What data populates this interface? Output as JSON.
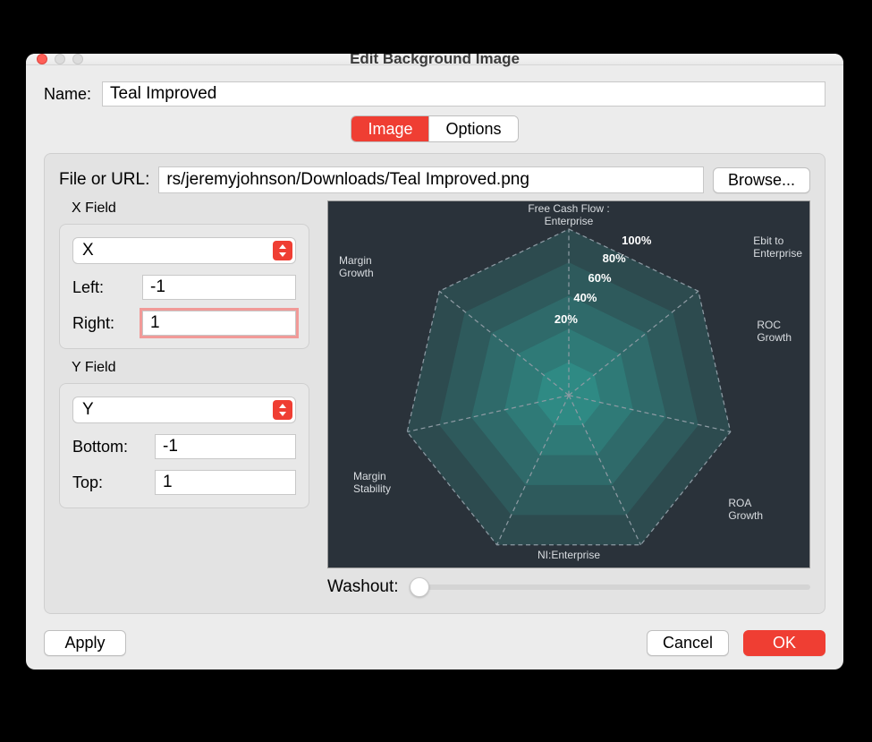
{
  "window": {
    "title": "Edit Background Image"
  },
  "name": {
    "label": "Name:",
    "value": "Teal Improved"
  },
  "tabs": {
    "image": "Image",
    "options": "Options",
    "active": "image"
  },
  "file": {
    "label": "File or URL:",
    "value": "rs/jeremyjohnson/Downloads/Teal Improved.png",
    "browse": "Browse..."
  },
  "xfield": {
    "header": "X Field",
    "select": "X",
    "left_label": "Left:",
    "left_value": "-1",
    "right_label": "Right:",
    "right_value": "1"
  },
  "yfield": {
    "header": "Y Field",
    "select": "Y",
    "bottom_label": "Bottom:",
    "bottom_value": "-1",
    "top_label": "Top:",
    "top_value": "1"
  },
  "washout": {
    "label": "Washout:",
    "value": 0
  },
  "preview_chart": {
    "axes": [
      "Free Cash Flow : Enterprise",
      "Ebit to Enterprise",
      "ROC Growth",
      "ROA Growth",
      "NI:Enterprise",
      "Margin Stability",
      "Margin Growth"
    ],
    "ticks": [
      "20%",
      "40%",
      "60%",
      "80%",
      "100%"
    ]
  },
  "buttons": {
    "apply": "Apply",
    "cancel": "Cancel",
    "ok": "OK"
  }
}
